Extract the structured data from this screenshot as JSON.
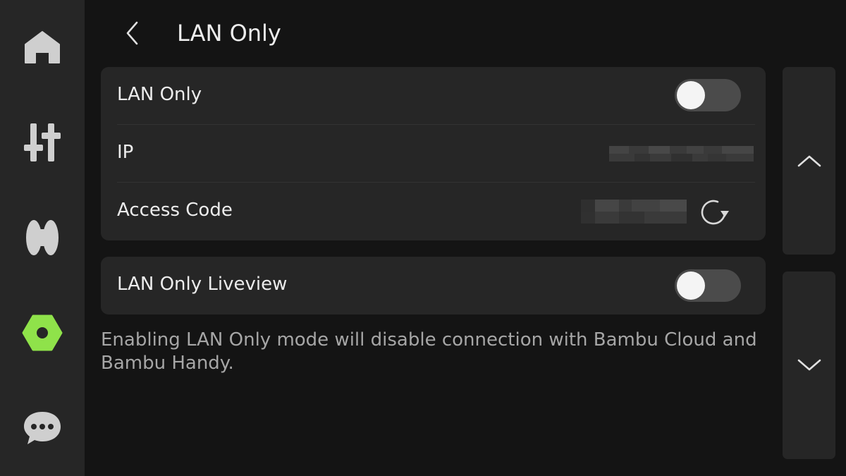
{
  "header": {
    "title": "LAN Only"
  },
  "sidebar": {
    "items": [
      {
        "icon": "home-icon"
      },
      {
        "icon": "sliders-icon"
      },
      {
        "icon": "filament-spool-icon"
      },
      {
        "icon": "settings-nut-icon",
        "active": true
      },
      {
        "icon": "chat-bubble-icon"
      }
    ],
    "active_color": "#8fe24a"
  },
  "settings": {
    "lan_only": {
      "label": "LAN Only",
      "enabled": false
    },
    "ip": {
      "label": "IP",
      "value_hidden": true
    },
    "access_code": {
      "label": "Access Code",
      "value_hidden": true,
      "action_icon": "refresh-icon"
    },
    "lan_only_liveview": {
      "label": "LAN Only Liveview",
      "enabled": false
    }
  },
  "footer_note": "Enabling LAN Only mode will disable connection with Bambu Cloud and Bambu Handy.",
  "scroll": {
    "up_icon": "chevron-up-icon",
    "down_icon": "chevron-down-icon"
  }
}
